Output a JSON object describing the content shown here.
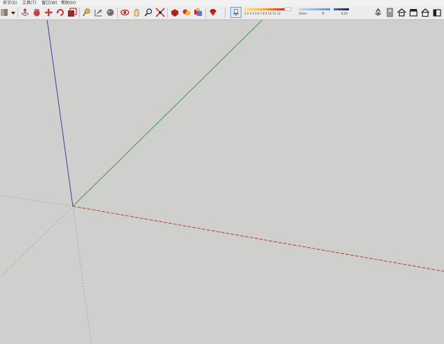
{
  "menu": {
    "items": [
      "名字(S)",
      "工具(T)",
      "窗口(W)",
      "帮助(H)"
    ]
  },
  "toolbar": {
    "tools": [
      "materials-icon",
      "dropdown-arrow-icon",
      "push-pull-icon",
      "follow-me-icon",
      "move-icon",
      "rotate-icon",
      "scale-icon",
      "tape-measure-icon",
      "dimension-icon",
      "paint-bucket-icon",
      "orbit-icon",
      "pan-icon",
      "zoom-icon",
      "zoom-extents-icon",
      "component-icon",
      "group-icon",
      "solid-tools-icon",
      "ruby-icon",
      "style-icon",
      "warehouse-icon",
      "iso-view-icon",
      "top-view-icon",
      "front-view-icon",
      "right-view-icon",
      "back-view-icon"
    ],
    "shadow_ticks": "1 2 3 4 5 6 7 8 9 10 11 12",
    "fog_left": "Dates",
    "fog_mid": "M",
    "fog_right": "8:00"
  },
  "colors": {
    "axis_red": "#c23a2a",
    "axis_green": "#3f9b3f",
    "axis_blue": "#3a3aa0",
    "canvas_bg": "#cfcfcd"
  }
}
